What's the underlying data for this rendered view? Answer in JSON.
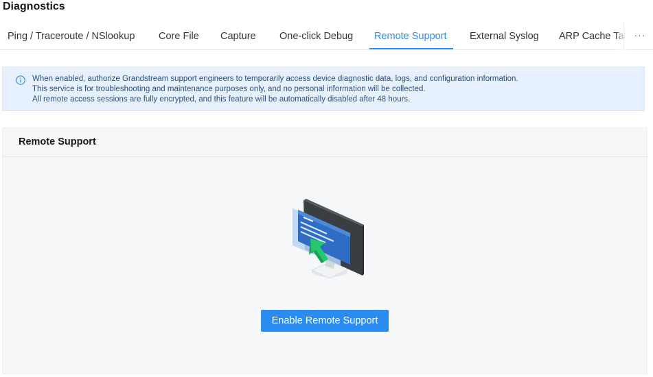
{
  "page": {
    "title": "Diagnostics"
  },
  "tabs": [
    {
      "label": "Ping / Traceroute / NSlookup",
      "active": false
    },
    {
      "label": "Core File",
      "active": false
    },
    {
      "label": "Capture",
      "active": false
    },
    {
      "label": "One-click Debug",
      "active": false
    },
    {
      "label": "Remote Support",
      "active": true
    },
    {
      "label": "External Syslog",
      "active": false
    },
    {
      "label": "ARP Cache Table",
      "active": false
    }
  ],
  "tab_more": {
    "label": "···"
  },
  "notice": {
    "icon": "info-circle-icon",
    "lines": [
      "When enabled, authorize Grandstream support engineers to temporarily access device diagnostic data, logs, and configuration information.",
      "This service is for troubleshooting and maintenance purposes only, and no personal information will be collected.",
      "All remote access sessions are fully encrypted, and this feature will be automatically disabled after 48 hours."
    ]
  },
  "panel": {
    "title": "Remote Support",
    "illustration": "remote-monitor-icon",
    "button_label": "Enable Remote Support"
  },
  "colors": {
    "accent": "#2b8cf0",
    "notice_bg": "#e6f1fd",
    "panel_bg": "#f6f7f9"
  }
}
